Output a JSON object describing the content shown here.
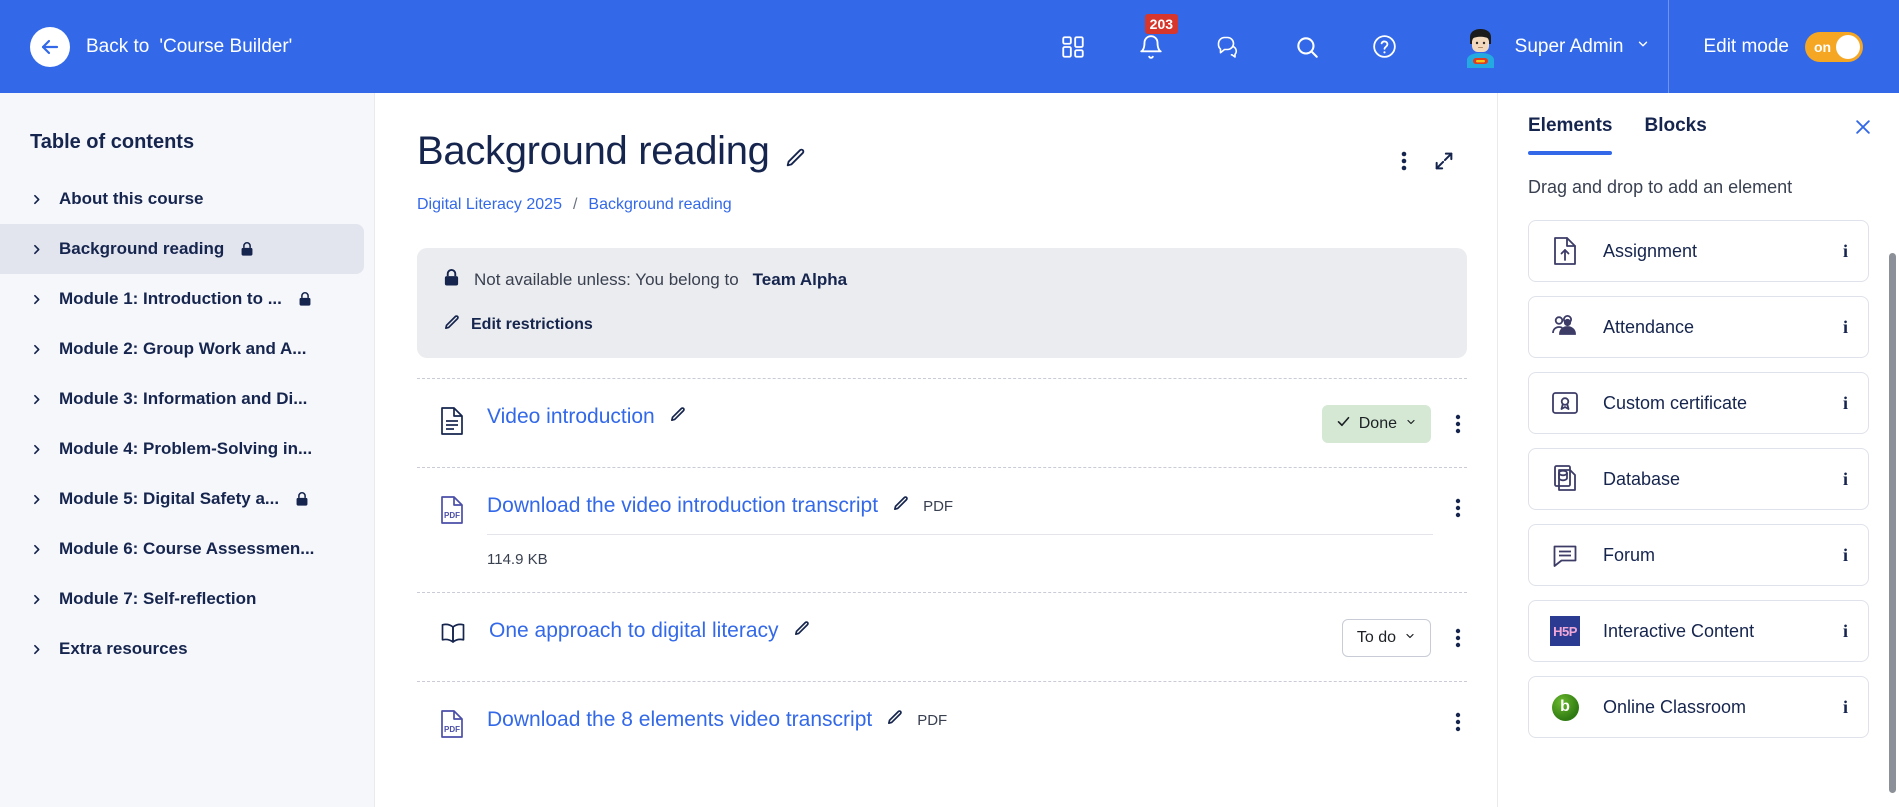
{
  "navbar": {
    "back_label": "Back to",
    "back_context": "'Course Builder'",
    "notification_badge": "203",
    "user_name": "Super Admin",
    "edit_mode_label": "Edit mode",
    "toggle_state": "on",
    "brand_color": "#3369E8",
    "toggle_color": "#F5A623",
    "badge_color": "#D6362B"
  },
  "sidebar": {
    "title": "Table of contents",
    "items": [
      {
        "label": "About this course",
        "locked": false,
        "active": false
      },
      {
        "label": "Background reading",
        "locked": true,
        "active": true
      },
      {
        "label": "Module 1: Introduction to ...",
        "locked": true,
        "active": false
      },
      {
        "label": "Module 2: Group Work and A...",
        "locked": false,
        "active": false
      },
      {
        "label": "Module 3: Information and Di...",
        "locked": false,
        "active": false
      },
      {
        "label": "Module 4: Problem-Solving in...",
        "locked": false,
        "active": false
      },
      {
        "label": "Module 5: Digital Safety a...",
        "locked": true,
        "active": false
      },
      {
        "label": "Module 6: Course Assessmen...",
        "locked": false,
        "active": false
      },
      {
        "label": "Module 7: Self-reflection",
        "locked": false,
        "active": false
      },
      {
        "label": "Extra resources",
        "locked": false,
        "active": false
      }
    ]
  },
  "main": {
    "page_title": "Background reading",
    "breadcrumb": {
      "course": "Digital Literacy 2025",
      "separator": "/",
      "current": "Background reading"
    },
    "restriction": {
      "text_prefix": "Not available unless: You belong to",
      "group": "Team Alpha",
      "edit_label": "Edit restrictions"
    },
    "activities": [
      {
        "icon": "page-icon",
        "title": "Video introduction",
        "type": "",
        "meta": "",
        "status": "Done",
        "status_kind": "done"
      },
      {
        "icon": "pdf-icon",
        "title": "Download the video introduction transcript",
        "type": "PDF",
        "meta": "114.9 KB",
        "status": "",
        "status_kind": "none"
      },
      {
        "icon": "book-icon",
        "title": "One approach to digital literacy",
        "type": "",
        "meta": "",
        "status": "To do",
        "status_kind": "todo"
      },
      {
        "icon": "pdf-icon",
        "title": "Download the 8 elements video transcript",
        "type": "PDF",
        "meta": "",
        "status": "",
        "status_kind": "none"
      }
    ]
  },
  "right_panel": {
    "tabs": [
      {
        "label": "Elements",
        "active": true
      },
      {
        "label": "Blocks",
        "active": false
      }
    ],
    "hint": "Drag and drop to add an element",
    "info_glyph": "i",
    "elements": [
      {
        "label": "Assignment",
        "icon": "assignment-icon"
      },
      {
        "label": "Attendance",
        "icon": "attendance-icon"
      },
      {
        "label": "Custom certificate",
        "icon": "certificate-icon"
      },
      {
        "label": "Database",
        "icon": "database-icon"
      },
      {
        "label": "Forum",
        "icon": "forum-icon"
      },
      {
        "label": "Interactive Content",
        "icon": "h5p-icon"
      },
      {
        "label": "Online Classroom",
        "icon": "bigbluebutton-icon"
      }
    ]
  }
}
